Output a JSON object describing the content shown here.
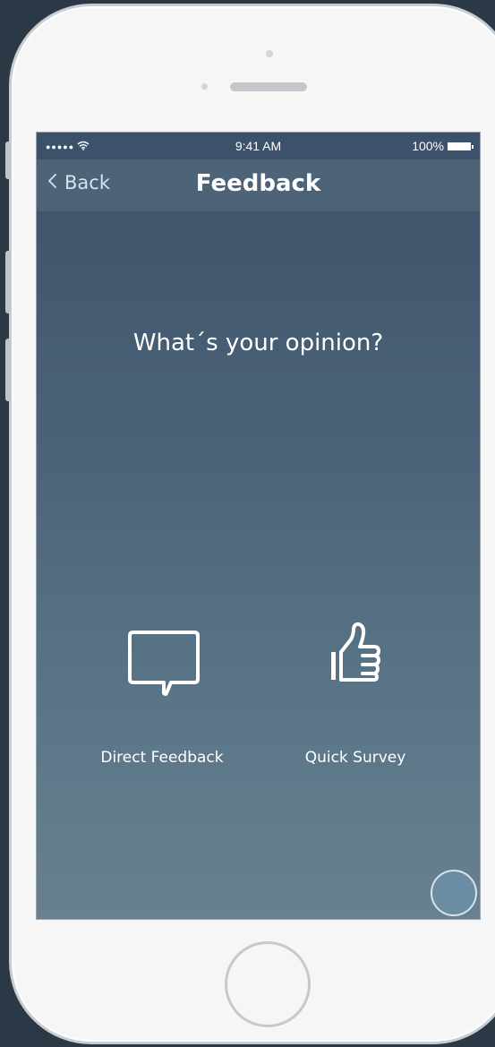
{
  "status_bar": {
    "signal_dots": "●●●●●",
    "wifi_icon": "wifi-icon",
    "time": "9:41 AM",
    "battery_percent": "100%",
    "battery_level": 1.0
  },
  "nav": {
    "back_label": "Back",
    "back_icon": "chevron-left-icon",
    "title": "Feedback"
  },
  "main": {
    "question": "What´s your opinion?",
    "options": [
      {
        "label": "Direct Feedback",
        "icon": "speech-bubble-icon"
      },
      {
        "label": "Quick Survey",
        "icon": "thumbs-up-icon"
      }
    ]
  },
  "colors": {
    "screen_top": "#3c5169",
    "screen_bottom": "#67818f",
    "nav_bar": "#4d6378",
    "back_text": "#d6e2ee",
    "assist_button": "#6a8da3",
    "device_body": "#f6f6f7"
  }
}
